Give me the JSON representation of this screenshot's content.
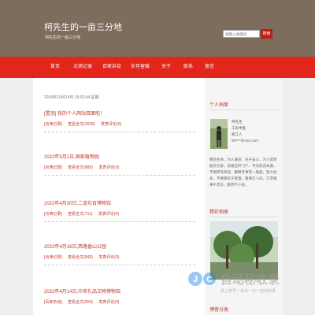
{
  "header": {
    "site_title": "柯先生的一亩三分地",
    "site_subtitle": "柯先生的一亩三分地",
    "search_placeholder": "请输入关键词",
    "search_button": "搜索"
  },
  "nav": {
    "items": [
      "首页",
      "点滴记录",
      "百家杂烩",
      "岁月留痕",
      "关于",
      "联系",
      "留言"
    ]
  },
  "main": {
    "date_line": "2024年10月24日 19:02:44 星期",
    "posts": [
      {
        "title": "[置顶] 我的个人网站双面啦！",
        "category": "[点滴记录]",
        "views": "查看全文(2618)",
        "comments": "发表评论(0)"
      },
      {
        "title": "2022年5月1日,国家植物园",
        "category": "[点滴记录]",
        "views": "查看全文(883)",
        "comments": "发表评论(0)"
      },
      {
        "title": "2022年4月30日,二道坎百博物馆",
        "category": "[点滴记录]",
        "views": "查看全文(711)",
        "comments": "发表评论(0)"
      },
      {
        "title": "2022年4月16日,西路香山公园",
        "category": "[点滴记录]",
        "views": "查看全文(843)",
        "comments": "发表评论(0)"
      },
      {
        "title": "2022年4月14日,中央礼品文物博物馆",
        "category": "[百家杂烩]",
        "views": "查看全文(904)",
        "comments": "发表评论(0)"
      }
    ]
  },
  "sidebar": {
    "profile_title": "个人档案",
    "profile_lines": [
      "柯先生",
      "工农中医",
      "浙江人",
      "00****@163.com"
    ],
    "bio": "敬佑生命，为人谦逊，乐于奋斗，为人宽厚豁达包容，常被自开门户、不问前途本源，不图转弯病道，聚精专事完一般般，努力生命，不要那起于者理，重事在人间，只求做事干实在，勤劳不小会。",
    "album_title": "精彩相册",
    "blog_cat_title": "博客分类"
  },
  "watermark": {
    "brand": "自动秘收录",
    "sub": "做上榜号一来访一次一自动收录"
  },
  "colors": {
    "header_bg": "#7d6d5c",
    "nav_bg": "#e2261c",
    "accent": "#c0392b"
  }
}
